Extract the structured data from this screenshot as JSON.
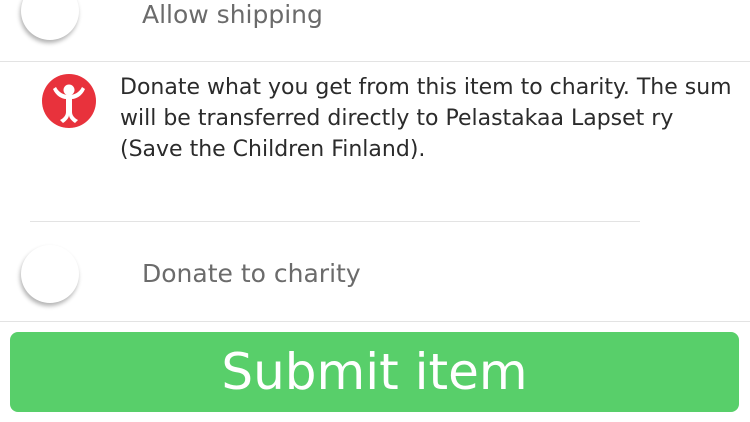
{
  "shipping": {
    "label": "Allow shipping",
    "enabled": false
  },
  "charity": {
    "logo_icon": "save-the-children-logo",
    "logo_color": "#e8323c",
    "description": "Donate what you get from this item to charity. The sum will be transferred directly to  Pelastakaa Lapset ry (Save the Children Finland).",
    "toggle_label": "Donate to charity",
    "enabled": false
  },
  "submit": {
    "label": "Submit item",
    "color": "#58cf6a"
  }
}
